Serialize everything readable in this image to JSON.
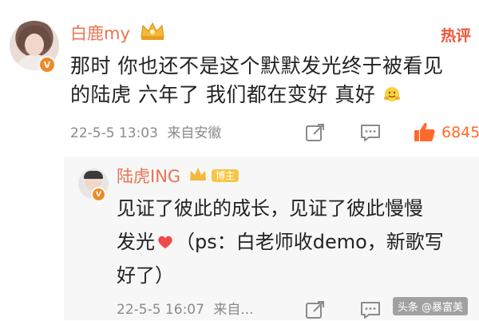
{
  "main_comment": {
    "username": "白鹿my",
    "hot_label": "热评",
    "text_line1": "那时 你也还不是这个默默发光终于被看见",
    "text_line2": "的陆虎 六年了 我们都在变好 真好",
    "emoji_name": "hug-emoji",
    "timestamp": "22-5-5 13:03",
    "source": "来自安徽",
    "like_count": "6845",
    "colors": {
      "username": "#eb7350",
      "hot": "#f0553a",
      "like": "#ff6a2b"
    }
  },
  "reply": {
    "username": "陆虎ING",
    "badge": "博主",
    "text_line1": "见证了彼此的成长，见证了彼此慢慢",
    "text_line2a": "发光",
    "text_line2b": "（ps：白老师收demo，新歌写",
    "text_line3": "好了）",
    "timestamp": "22-5-5 16:07",
    "source": "来自..."
  },
  "watermark": "头条 @暴富美"
}
